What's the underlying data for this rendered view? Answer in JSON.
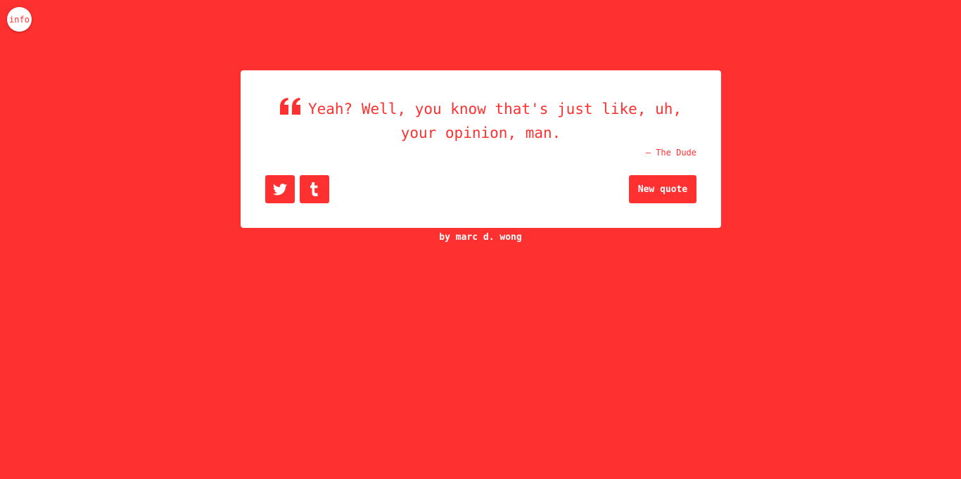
{
  "info_button": {
    "label": "info"
  },
  "quote": {
    "text": "Yeah? Well, you know that's just like, uh, your opinion, man.",
    "author": "— The Dude"
  },
  "actions": {
    "twitter_icon": "twitter-icon",
    "tumblr_icon": "tumblr-icon",
    "new_quote_label": "New quote"
  },
  "footer": {
    "credit": "by marc d. wong"
  },
  "colors": {
    "accent": "#ff3030",
    "card": "#ffffff"
  }
}
